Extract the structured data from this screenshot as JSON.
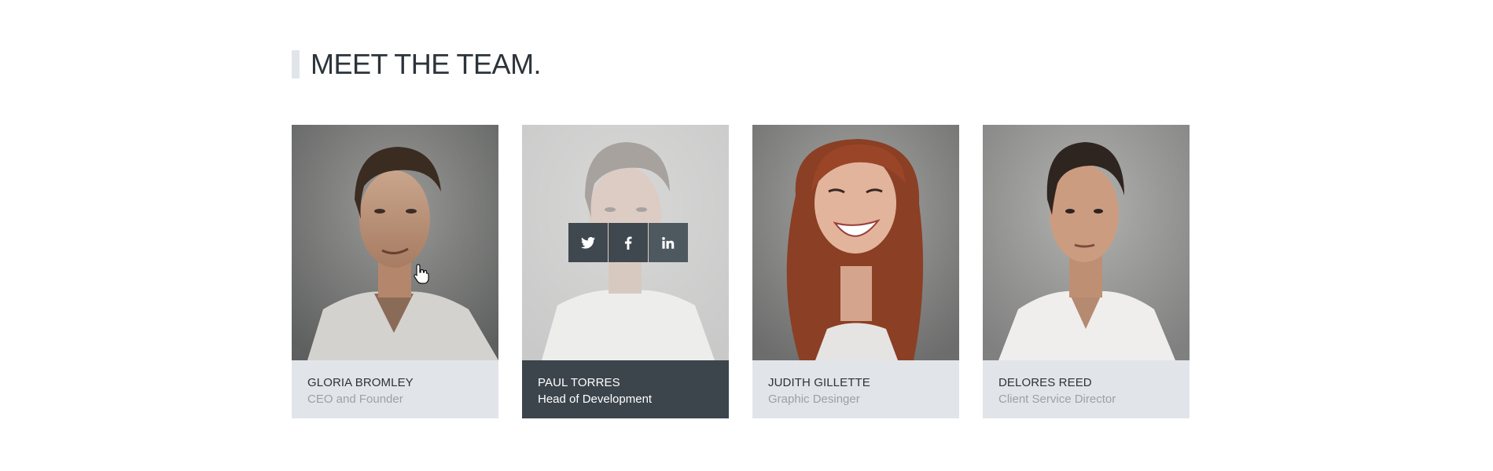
{
  "section": {
    "title": "MEET THE TEAM."
  },
  "team": [
    {
      "name": "GLORIA BROMLEY",
      "role": "CEO and Founder"
    },
    {
      "name": "PAUL TORRES",
      "role": "Head of Development"
    },
    {
      "name": "JUDITH GILLETTE",
      "role": "Graphic Desinger"
    },
    {
      "name": "DELORES REED",
      "role": "Client Service Director"
    }
  ],
  "social": {
    "icons": [
      "twitter-icon",
      "facebook-icon",
      "linkedin-icon"
    ],
    "glyphs": [
      "t",
      "f",
      "in"
    ]
  },
  "colors": {
    "caption_bg": "#e1e5e9",
    "caption_active_bg": "#3c454c",
    "heading_text": "#2c3339",
    "role_text": "#9aa1a7",
    "social_btn": "#3f484f"
  }
}
